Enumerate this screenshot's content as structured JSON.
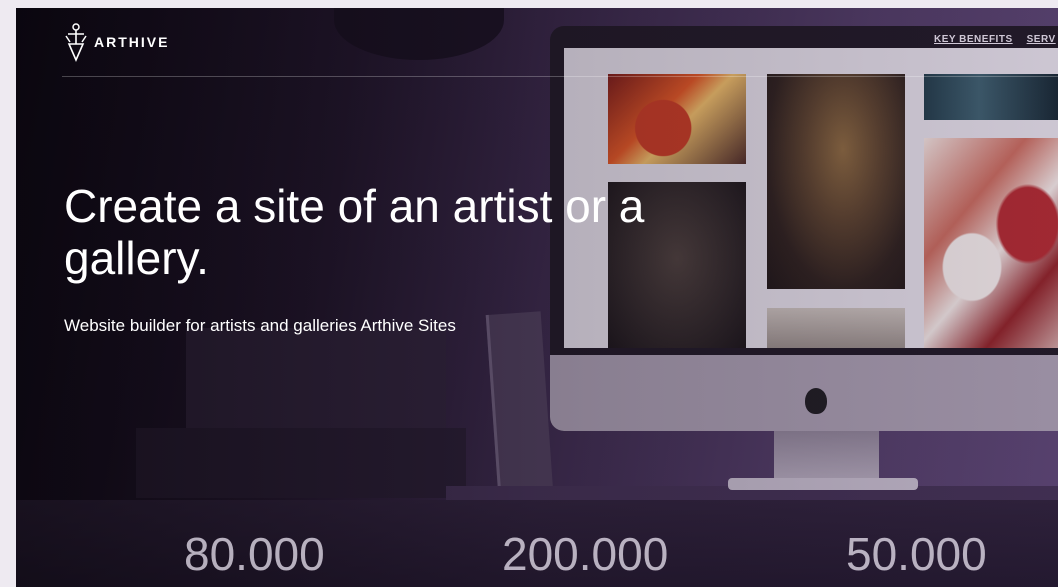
{
  "brand": {
    "name": "ARTHIVE"
  },
  "nav": {
    "items": [
      "KEY BENEFITS",
      "SERV"
    ]
  },
  "hero": {
    "headline": "Create a site of an artist or a gallery.",
    "subtitle": "Website builder for artists and galleries Arthive Sites"
  },
  "stats": [
    "80.000",
    "200.000",
    "50.000"
  ],
  "colors": {
    "accent": "#5a4570",
    "text": "#ffffff"
  }
}
